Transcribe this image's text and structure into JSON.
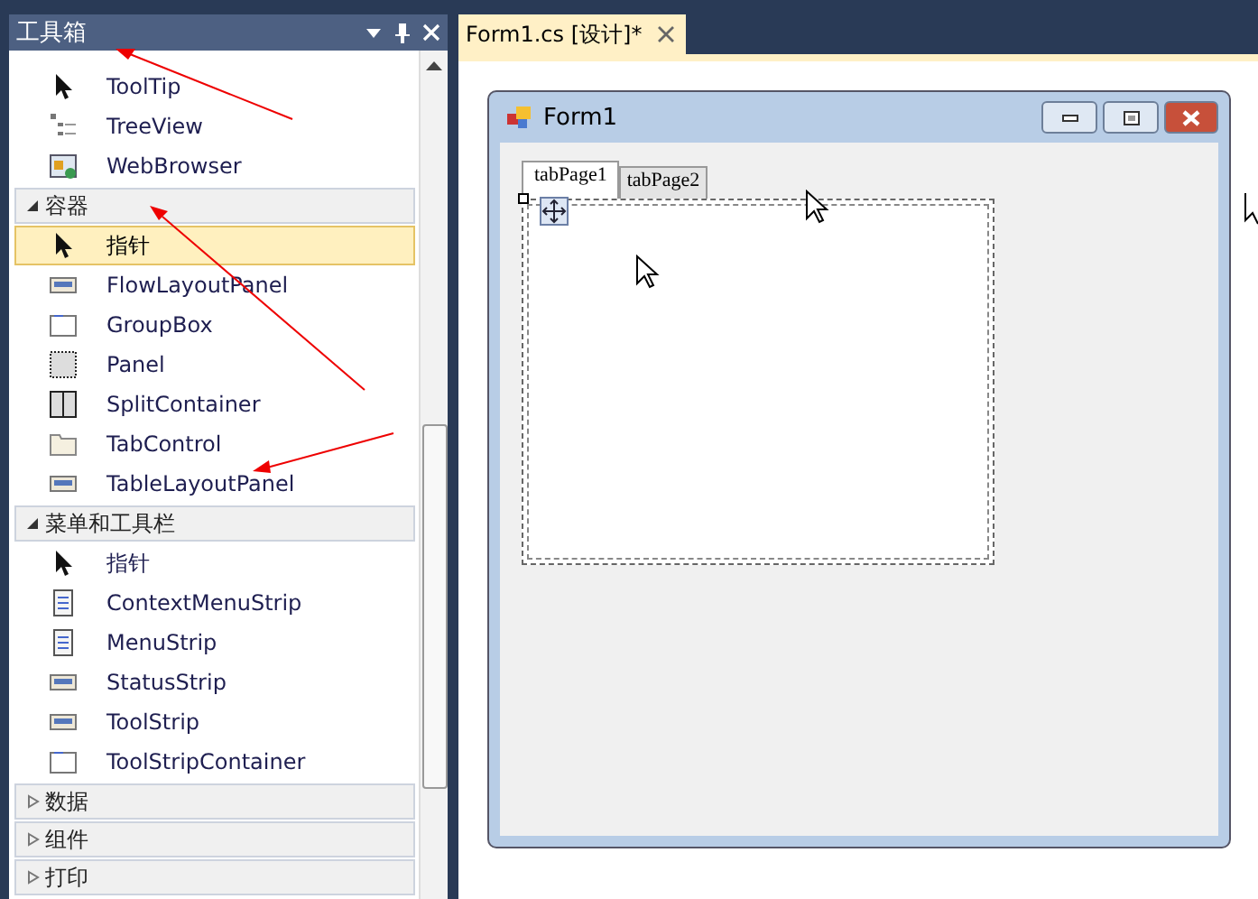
{
  "toolbox": {
    "title": "工具箱",
    "items": [
      {
        "kind": "item",
        "label": "ToolTip",
        "selected": false
      },
      {
        "kind": "item",
        "label": "TreeView",
        "selected": false
      },
      {
        "kind": "item",
        "label": "WebBrowser",
        "selected": false
      },
      {
        "kind": "header",
        "label": "容器",
        "expanded": true
      },
      {
        "kind": "item",
        "label": "指针",
        "selected": true
      },
      {
        "kind": "item",
        "label": "FlowLayoutPanel",
        "selected": false
      },
      {
        "kind": "item",
        "label": "GroupBox",
        "selected": false
      },
      {
        "kind": "item",
        "label": "Panel",
        "selected": false
      },
      {
        "kind": "item",
        "label": "SplitContainer",
        "selected": false
      },
      {
        "kind": "item",
        "label": "TabControl",
        "selected": false
      },
      {
        "kind": "item",
        "label": "TableLayoutPanel",
        "selected": false
      },
      {
        "kind": "header",
        "label": "菜单和工具栏",
        "expanded": true
      },
      {
        "kind": "item",
        "label": "指针",
        "selected": false
      },
      {
        "kind": "item",
        "label": "ContextMenuStrip",
        "selected": false
      },
      {
        "kind": "item",
        "label": "MenuStrip",
        "selected": false
      },
      {
        "kind": "item",
        "label": "StatusStrip",
        "selected": false
      },
      {
        "kind": "item",
        "label": "ToolStrip",
        "selected": false
      },
      {
        "kind": "item",
        "label": "ToolStripContainer",
        "selected": false
      },
      {
        "kind": "header",
        "label": "数据",
        "expanded": false
      },
      {
        "kind": "header",
        "label": "组件",
        "expanded": false
      },
      {
        "kind": "header",
        "label": "打印",
        "expanded": false
      }
    ]
  },
  "document_tab": {
    "label": "Form1.cs [设计]*",
    "selected": true
  },
  "form": {
    "title": "Form1",
    "tabs": [
      {
        "label": "tabPage1",
        "selected": true
      },
      {
        "label": "tabPage2",
        "selected": false
      }
    ]
  }
}
